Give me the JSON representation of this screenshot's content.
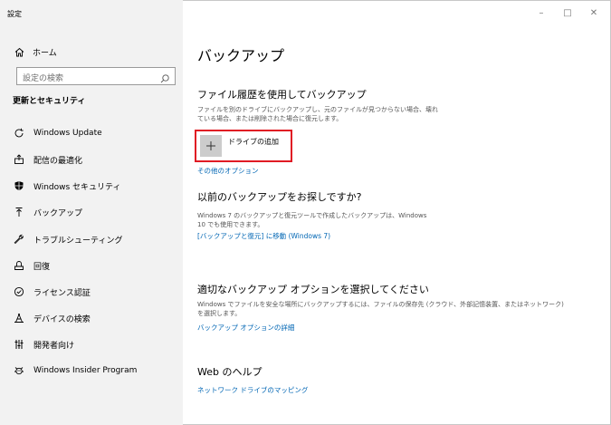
{
  "window": {
    "title": "設定",
    "minimize": "–",
    "maximize": "□",
    "close": "✕"
  },
  "sidebar": {
    "home_label": "ホーム",
    "search_placeholder": "設定の検索",
    "section_title": "更新とセキュリティ",
    "items": [
      {
        "label": "Windows Update",
        "icon": "sync-icon"
      },
      {
        "label": "配信の最適化",
        "icon": "delivery-optimization-icon"
      },
      {
        "label": "Windows セキュリティ",
        "icon": "shield-icon"
      },
      {
        "label": "バックアップ",
        "icon": "backup-arrow-icon"
      },
      {
        "label": "トラブルシューティング",
        "icon": "wrench-icon"
      },
      {
        "label": "回復",
        "icon": "recovery-icon"
      },
      {
        "label": "ライセンス認証",
        "icon": "check-circle-icon"
      },
      {
        "label": "デバイスの検索",
        "icon": "find-device-icon"
      },
      {
        "label": "開発者向け",
        "icon": "developer-icon"
      },
      {
        "label": "Windows Insider Program",
        "icon": "insider-icon"
      }
    ]
  },
  "main": {
    "page_title": "バックアップ",
    "file_history": {
      "heading": "ファイル履歴を使用してバックアップ",
      "desc_line1": "ファイルを別のドライブにバックアップし、元のファイルが見つからない場合、壊れ",
      "desc_line2": "ている場合、または削除された場合に復元します。",
      "add_drive_label": "ドライブの追加",
      "more_options_link": "その他のオプション"
    },
    "older_backup": {
      "heading": "以前のバックアップをお探しですか?",
      "desc_line1": "Windows 7 のバックアップと復元ツールで作成したバックアップは、Windows",
      "desc_line2": "10 でも使用できます。",
      "link": "[バックアップと復元] に移動 (Windows 7)"
    },
    "choose_option": {
      "heading": "適切なバックアップ オプションを選択してください",
      "desc_line1": "Windows でファイルを安全な場所にバックアップするには、ファイルの保存先 (クラウド、外部記憶装置、またはネットワーク)",
      "desc_line2": "を選択します。",
      "link": "バックアップ オプションの詳細"
    },
    "web_help": {
      "heading": "Web のヘルプ",
      "link": "ネットワーク ドライブのマッピング"
    }
  },
  "colors": {
    "sidebar_bg": "#f2f2f2",
    "link": "#0066b4",
    "highlight_border": "#e01b24"
  }
}
